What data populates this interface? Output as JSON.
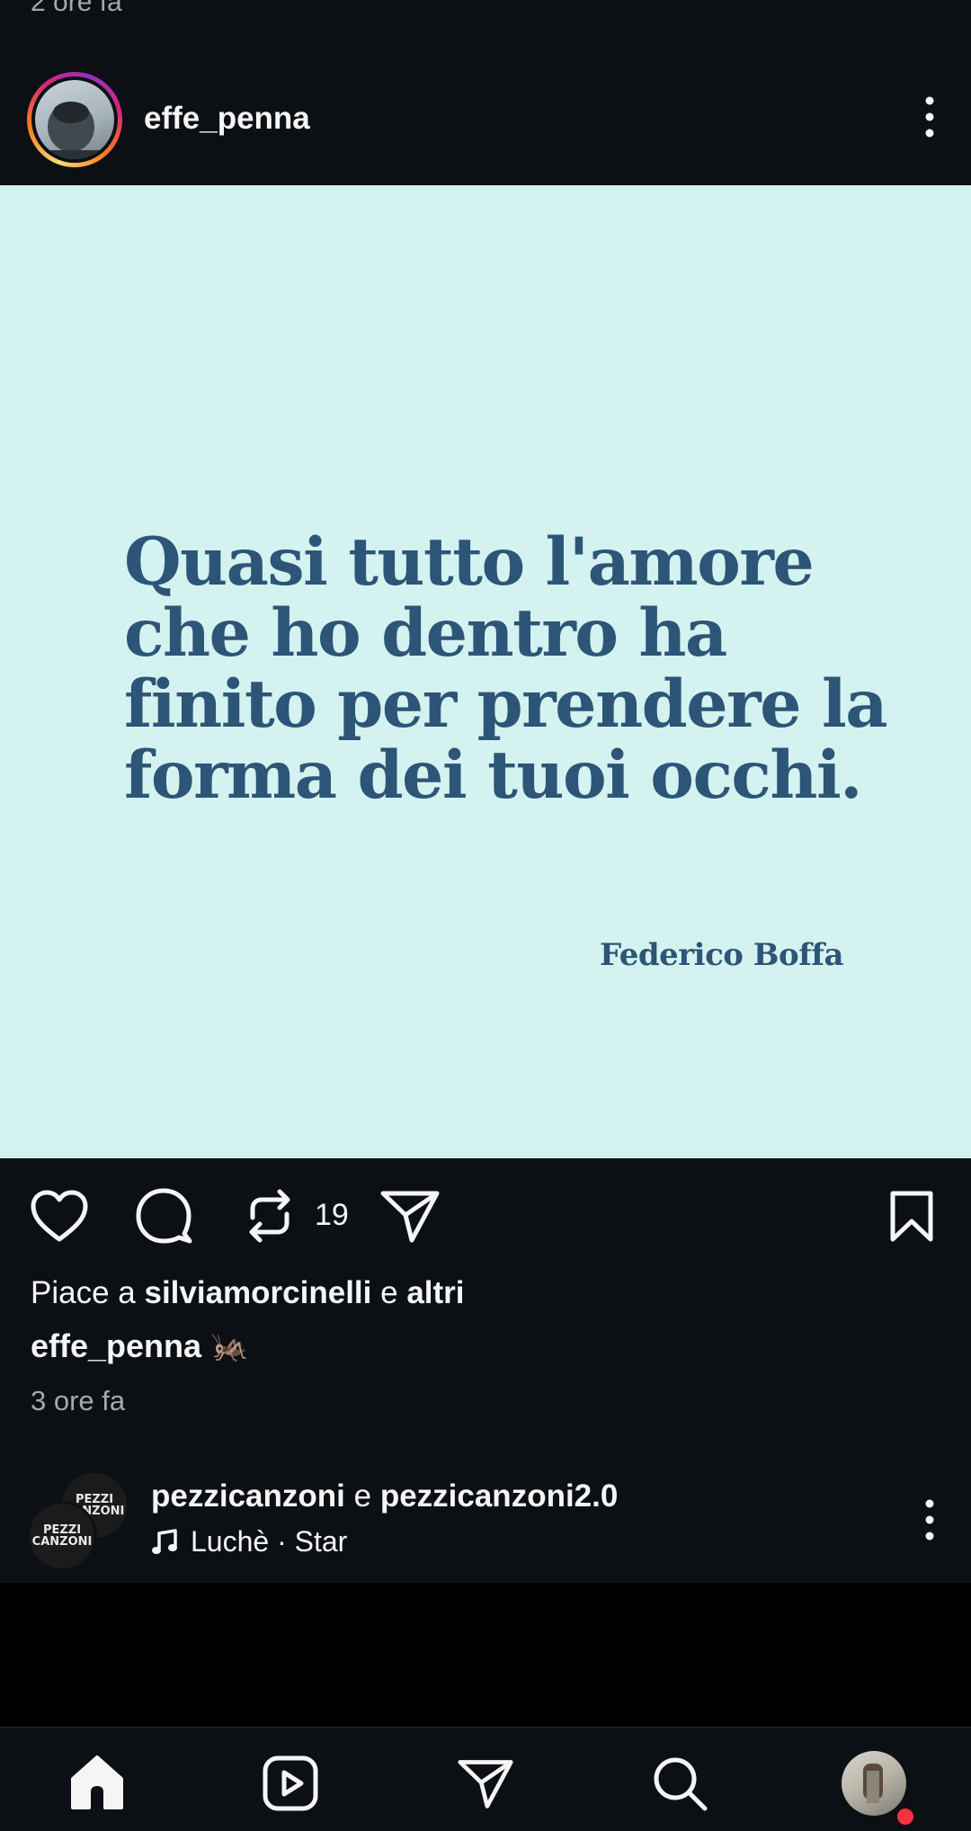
{
  "previous_post": {
    "timestamp": "2 ore fa"
  },
  "post": {
    "username": "effe_penna",
    "quote": "Quasi tutto l'amore\nche ho dentro ha\nfinito per prendere la\nforma dei tuoi occhi.",
    "author": "Federico Boffa",
    "repost_count": "19",
    "likes": {
      "prefix": "Piace a",
      "user": "silviamorcinelli",
      "conj": "e",
      "others": "altri"
    },
    "caption_user": "effe_penna",
    "caption_emoji": "🦗",
    "timestamp": "3 ore fa",
    "colors": {
      "image_bg": "#d4f2f0",
      "quote_text": "#2c5577"
    }
  },
  "next_post": {
    "user1": "pezzicanzoni",
    "conj": "e",
    "user2": "pezzicanzoni2.0",
    "song": "Luchè · Star",
    "avatar_text_1": "PEZZI CANZONI",
    "avatar_text_2": "PEZZI CANZONI"
  },
  "icons": [
    "more-vertical-icon",
    "heart-icon",
    "comment-icon",
    "repost-icon",
    "share-icon",
    "bookmark-icon",
    "music-note-icon",
    "home-icon",
    "reels-icon",
    "direct-icon",
    "search-icon"
  ]
}
